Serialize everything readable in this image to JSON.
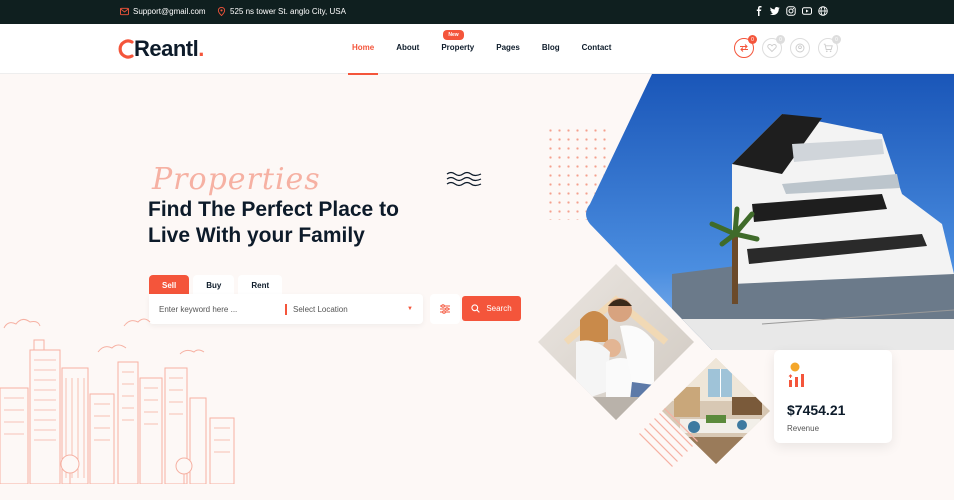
{
  "topbar": {
    "email": "Support@gmail.com",
    "address": "525 ns tower St. anglo City, USA",
    "social_icons": [
      "facebook-icon",
      "twitter-icon",
      "instagram-icon",
      "youtube-icon",
      "globe-icon"
    ]
  },
  "header": {
    "logo_text": "Reantl",
    "logo_dot": ".",
    "nav": [
      {
        "label": "Home",
        "active": true
      },
      {
        "label": "About"
      },
      {
        "label": "Property",
        "badge": "New"
      },
      {
        "label": "Pages"
      },
      {
        "label": "Blog"
      },
      {
        "label": "Contact"
      }
    ],
    "icon_counts": [
      "0",
      "0",
      "0"
    ]
  },
  "hero": {
    "script_text": "Properties",
    "headline_line1": "Find The Perfect Place to",
    "headline_line2": "Live With your Family",
    "tabs": [
      "Sell",
      "Buy",
      "Rent"
    ],
    "keyword_placeholder": "Enter keyword here ...",
    "location_placeholder": "Select Location",
    "search_label": "Search"
  },
  "stats": {
    "value": "$7454.21",
    "label": "Revenue"
  },
  "colors": {
    "accent": "#f4553b",
    "dark": "#0f1f1f",
    "background": "#fdf8f6"
  }
}
